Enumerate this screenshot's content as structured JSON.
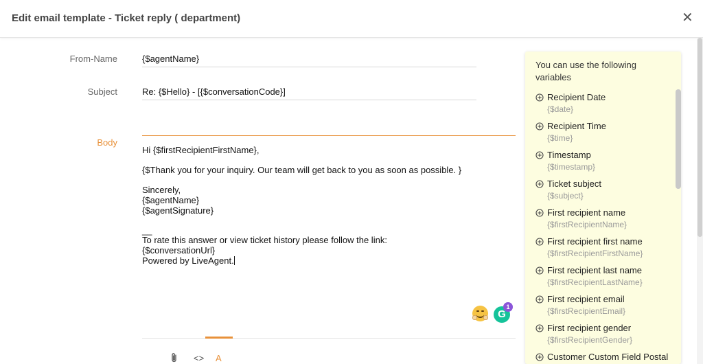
{
  "dialog": {
    "title": "Edit email template - Ticket reply ( department)",
    "close_glyph": "✕"
  },
  "form": {
    "from_name_label": "From-Name",
    "from_name_value": "{$agentName}",
    "subject_label": "Subject",
    "subject_value": "Re: {$Hello} - [{$conversationCode}]",
    "body_label": "Body"
  },
  "body_lines": [
    "Hi {$firstRecipientFirstName},",
    "",
    "{$Thank you for your inquiry. Our team will get back to you as soon as possible. }",
    "",
    "Sincerely,",
    "{$agentName}",
    "{$agentSignature}",
    "",
    "__",
    "To rate this answer or view ticket history please follow the link:",
    "{$conversationUrl}",
    "Powered by LiveAgent."
  ],
  "grammarly": {
    "letter": "G",
    "badge_count": "1"
  },
  "toolbar": {
    "code_glyph": "<>",
    "format_glyph": "A"
  },
  "variables": {
    "header": "You can use the following variables",
    "items": [
      {
        "name": "Recipient Date",
        "code": "{$date}"
      },
      {
        "name": "Recipient Time",
        "code": "{$time}"
      },
      {
        "name": "Timestamp",
        "code": "{$timestamp}"
      },
      {
        "name": "Ticket subject",
        "code": "{$subject}"
      },
      {
        "name": "First recipient name",
        "code": "{$firstRecipientName}"
      },
      {
        "name": "First recipient first name",
        "code": "{$firstRecipientFirstName}"
      },
      {
        "name": "First recipient last name",
        "code": "{$firstRecipientLastName}"
      },
      {
        "name": "First recipient email",
        "code": "{$firstRecipientEmail}"
      },
      {
        "name": "First recipient gender",
        "code": "{$firstRecipientGender}"
      },
      {
        "name": "Customer Custom Field Postal",
        "code": ""
      }
    ]
  },
  "colors": {
    "accent_orange": "#e8913a",
    "panel_bg": "#fdfde0",
    "grammarly_green": "#15c39a",
    "badge_purple": "#8b56d9"
  },
  "icons": [
    "close-icon",
    "emoji-icon",
    "grammarly-icon",
    "attachment-icon",
    "code-view-icon",
    "text-format-icon",
    "add-variable-icon"
  ]
}
